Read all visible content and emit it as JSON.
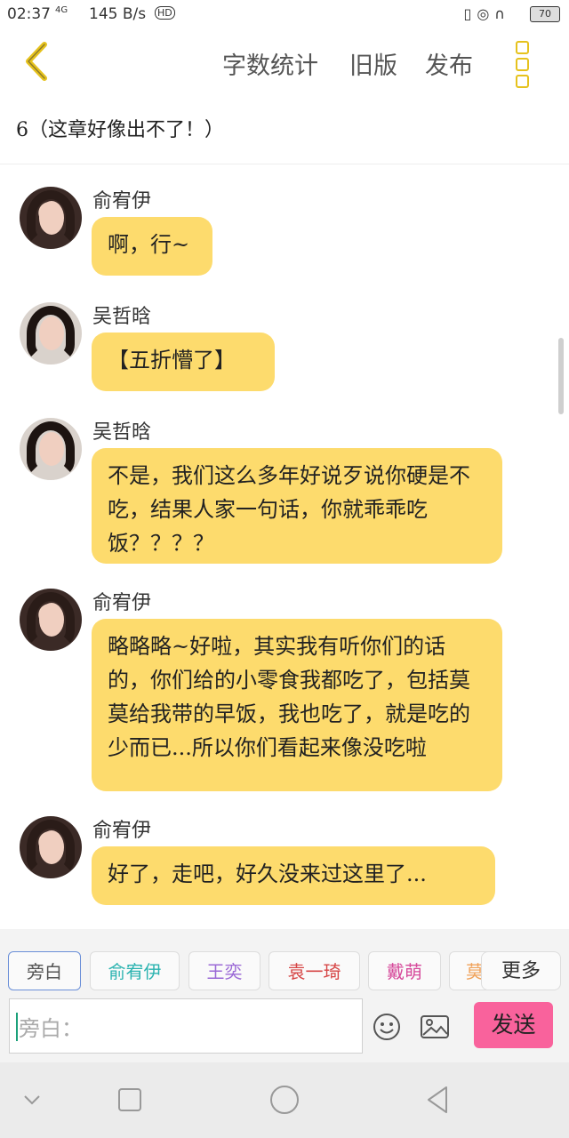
{
  "status_bar": {
    "time": "02:37",
    "network": "4G",
    "speed": "145 B/s",
    "hd": "HD",
    "icons": [
      "vibrate-icon",
      "lock-rotation-icon",
      "headphones-icon"
    ],
    "battery": "70"
  },
  "toolbar": {
    "word_count_label": "字数统计",
    "old_version_label": "旧版",
    "publish_label": "发布",
    "accent": "#e6c21d"
  },
  "chapter_title": "6（这章好像出不了！）",
  "messages": [
    {
      "sender": "俞宥伊",
      "text": "啊，行~"
    },
    {
      "sender": "吴哲晗",
      "text": "【五折懵了】"
    },
    {
      "sender": "吴哲晗",
      "text": "不是，我们这么多年好说歹说你硬是不吃，结果人家一句话，你就乖乖吃饭？？？？"
    },
    {
      "sender": "俞宥伊",
      "text": "略略略~好啦，其实我有听你们的话的，你们给的小零食我都吃了，包括莫莫给我带的早饭，我也吃了，就是吃的少而已...所以你们看起来像没吃啦"
    },
    {
      "sender": "俞宥伊",
      "text": "好了，走吧，好久没来过这里了..."
    }
  ],
  "characters": [
    {
      "label": "旁白",
      "color": "#555555",
      "selected": true
    },
    {
      "label": "俞宥伊",
      "color": "#2bb3b0"
    },
    {
      "label": "王奕",
      "color": "#9b6ad6"
    },
    {
      "label": "袁一琦",
      "color": "#d64545"
    },
    {
      "label": "戴萌",
      "color": "#d64a9b"
    },
    {
      "label": "莫",
      "color": "#f0a25a"
    }
  ],
  "more_label": "更多",
  "input": {
    "placeholder": "旁白："
  },
  "send_label": "发送",
  "bubble_color": "#fddb6d",
  "send_color": "#f9629c"
}
